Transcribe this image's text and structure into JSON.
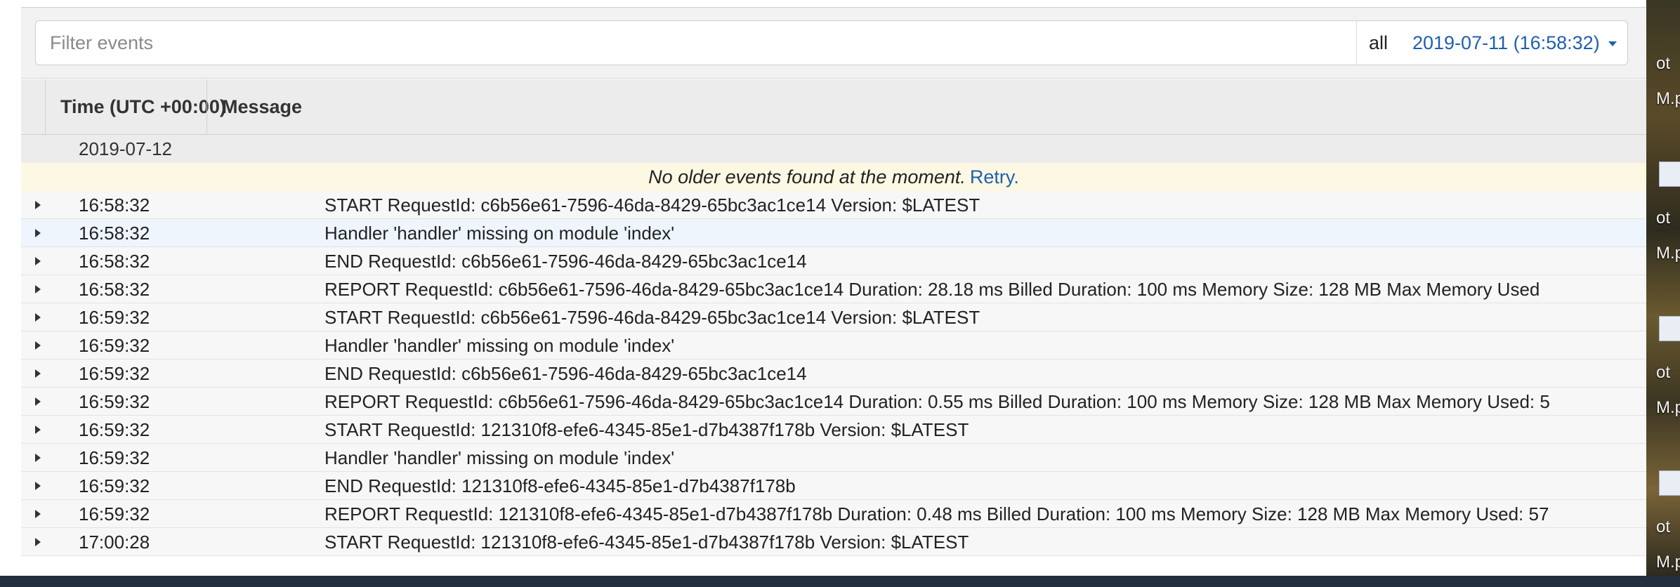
{
  "filter": {
    "placeholder": "Filter events",
    "range_all": "all",
    "range_date": "2019-07-11 (16:58:32)"
  },
  "columns": {
    "time": "Time (UTC +00:00)",
    "message": "Message"
  },
  "date_group": "2019-07-12",
  "older_notice": {
    "text": "No older events found at the moment.",
    "retry": "Retry."
  },
  "events": [
    {
      "time": "16:58:32",
      "message": "START RequestId: c6b56e61-7596-46da-8429-65bc3ac1ce14 Version: $LATEST"
    },
    {
      "time": "16:58:32",
      "message": "Handler 'handler' missing on module 'index'"
    },
    {
      "time": "16:58:32",
      "message": "END RequestId: c6b56e61-7596-46da-8429-65bc3ac1ce14"
    },
    {
      "time": "16:58:32",
      "message": "REPORT RequestId: c6b56e61-7596-46da-8429-65bc3ac1ce14 Duration: 28.18 ms Billed Duration: 100 ms Memory Size: 128 MB Max Memory Used"
    },
    {
      "time": "16:59:32",
      "message": "START RequestId: c6b56e61-7596-46da-8429-65bc3ac1ce14 Version: $LATEST"
    },
    {
      "time": "16:59:32",
      "message": "Handler 'handler' missing on module 'index'"
    },
    {
      "time": "16:59:32",
      "message": "END RequestId: c6b56e61-7596-46da-8429-65bc3ac1ce14"
    },
    {
      "time": "16:59:32",
      "message": "REPORT RequestId: c6b56e61-7596-46da-8429-65bc3ac1ce14 Duration: 0.55 ms Billed Duration: 100 ms Memory Size: 128 MB Max Memory Used: 5"
    },
    {
      "time": "16:59:32",
      "message": "START RequestId: 121310f8-efe6-4345-85e1-d7b4387f178b Version: $LATEST"
    },
    {
      "time": "16:59:32",
      "message": "Handler 'handler' missing on module 'index'"
    },
    {
      "time": "16:59:32",
      "message": "END RequestId: 121310f8-efe6-4345-85e1-d7b4387f178b"
    },
    {
      "time": "16:59:32",
      "message": "REPORT RequestId: 121310f8-efe6-4345-85e1-d7b4387f178b Duration: 0.48 ms Billed Duration: 100 ms Memory Size: 128 MB Max Memory Used: 57"
    },
    {
      "time": "17:00:28",
      "message": "START RequestId: 121310f8-efe6-4345-85e1-d7b4387f178b Version: $LATEST"
    }
  ],
  "desktop": {
    "labels": [
      "ot",
      "M.p",
      "ot",
      "M.p",
      "ot",
      "M.p",
      "ot",
      "M.p"
    ]
  },
  "colors": {
    "link": "#1f5fb0",
    "notice_bg": "#fcf8e3",
    "header_bg": "#ececec",
    "selected_row": "#eef5fd"
  }
}
